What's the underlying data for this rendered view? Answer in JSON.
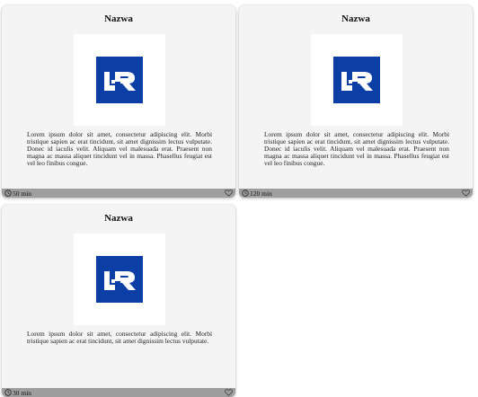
{
  "cards": [
    {
      "title": "Nazwa",
      "description": "Lorem ipsum dolor sit amet, consectetur adipiscing elit. Morbi tristique sapien ac erat tincidunt, sit amet dignissim lectus vulputate. Donec id iaculis velit. Aliquam vel malesuada erat. Praesent non magna ac massa aliquet tincidunt vel in massa. Phasellus feugiat est vel leo finibus congue.",
      "duration": "50 min",
      "image_icon": "university-logo-icon",
      "footer_icon": "heart-outline-icon"
    },
    {
      "title": "Nazwa",
      "description": "Lorem ipsum dolor sit amet, consectetur adipiscing elit. Morbi tristique sapien ac erat tincidunt, sit amet dignissim lectus vulputate. Donec id iaculis velit. Aliquam vel malesuada erat. Praesent non magna ac massa aliquet tincidunt vel in massa. Phasellus feugiat est vel leo finibus congue.",
      "duration": "120 min",
      "image_icon": "university-logo-icon",
      "footer_icon": "heart-outline-icon"
    },
    {
      "title": "Nazwa",
      "description": "Lorem ipsum dolor sit amet, consectetur adipiscing elit. Morbi tristique sapien ac erat tincidunt, sit amet dignissim lectus vulputate.",
      "duration": "30 min",
      "image_icon": "university-logo-icon",
      "footer_icon": "heart-outline-icon"
    }
  ],
  "colors": {
    "card_background": "#f4f4f4",
    "footer_background": "#9e9e9e",
    "logo_blue": "#0b3fa6"
  }
}
